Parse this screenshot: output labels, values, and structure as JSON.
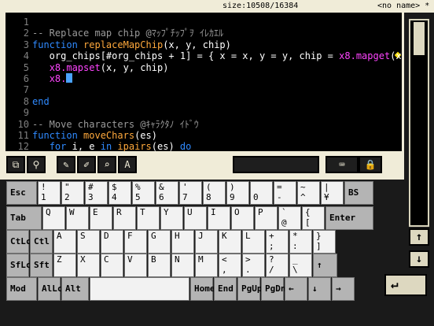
{
  "status": {
    "size": "size:10508/16384",
    "filename": "<no name> *"
  },
  "editor": {
    "lines": [
      {
        "n": "1",
        "segs": []
      },
      {
        "n": "2",
        "segs": [
          {
            "c": "cm",
            "t": "-- Replace map chip @ﾏｯﾌﾟﾁｯﾌﾟｦ ｲﾚｶｴﾙ"
          }
        ]
      },
      {
        "n": "3",
        "segs": [
          {
            "c": "kw",
            "t": "function "
          },
          {
            "c": "fn",
            "t": "replaceMapChip"
          },
          {
            "c": "tx",
            "t": "(x, y, chip)"
          }
        ]
      },
      {
        "n": "4",
        "segs": [
          {
            "c": "tx",
            "t": "   org_chips[#org_chips + 1] = { x = x, y = y, chip = "
          },
          {
            "c": "api",
            "t": "x8.mapget"
          },
          {
            "c": "tx",
            "t": "(x,"
          }
        ]
      },
      {
        "n": "5",
        "segs": [
          {
            "c": "tx",
            "t": "   "
          },
          {
            "c": "api",
            "t": "x8.mapset"
          },
          {
            "c": "tx",
            "t": "(x, y, chip)"
          }
        ]
      },
      {
        "n": "6",
        "segs": [
          {
            "c": "tx",
            "t": "   "
          },
          {
            "c": "api",
            "t": "x8."
          }
        ],
        "cursor": true
      },
      {
        "n": "7",
        "segs": []
      },
      {
        "n": "8",
        "segs": [
          {
            "c": "kw",
            "t": "end"
          }
        ]
      },
      {
        "n": "9",
        "segs": []
      },
      {
        "n": "10",
        "segs": [
          {
            "c": "cm",
            "t": "-- Move characters @ｷｬﾗｸﾀﾉ ｲﾄﾞｳ"
          }
        ]
      },
      {
        "n": "11",
        "segs": [
          {
            "c": "kw",
            "t": "function "
          },
          {
            "c": "fn",
            "t": "moveChars"
          },
          {
            "c": "tx",
            "t": "(es)"
          }
        ]
      },
      {
        "n": "12",
        "segs": [
          {
            "c": "tx",
            "t": "   "
          },
          {
            "c": "kw",
            "t": "for "
          },
          {
            "c": "tx",
            "t": "i, e "
          },
          {
            "c": "kw",
            "t": "in "
          },
          {
            "c": "fn",
            "t": "ipairs"
          },
          {
            "c": "tx",
            "t": "(es) "
          },
          {
            "c": "kw",
            "t": "do"
          }
        ]
      }
    ]
  },
  "toolbar": {
    "buttons": [
      {
        "name": "copy-button",
        "icon": "copy-icon",
        "label": "⧉"
      },
      {
        "name": "paste-button",
        "icon": "clipboard-icon",
        "label": "⚲"
      },
      {
        "name": "erase-button",
        "icon": "eraser-icon",
        "label": "✎"
      },
      {
        "name": "pen-button",
        "icon": "pen-icon",
        "label": "✐"
      },
      {
        "name": "search-button",
        "icon": "search-icon",
        "label": "⌕"
      },
      {
        "name": "font-button",
        "icon": "font-icon",
        "label": "A"
      },
      {
        "name": "blank-button",
        "icon": "blank-icon",
        "label": ""
      },
      {
        "name": "keyboard-button",
        "icon": "keyboard-icon",
        "label": "⌨"
      },
      {
        "name": "lock-button",
        "icon": "lock-icon",
        "label": "🔒"
      }
    ]
  },
  "keyboard": {
    "rows": [
      [
        {
          "k": "Esc",
          "s": "c",
          "dark": true
        },
        {
          "k": "!",
          "b": "1"
        },
        {
          "k": "\"",
          "b": "2"
        },
        {
          "k": "#",
          "b": "3"
        },
        {
          "k": "$",
          "b": "4"
        },
        {
          "k": "%",
          "b": "5"
        },
        {
          "k": "&",
          "b": "6"
        },
        {
          "k": "'",
          "b": "7"
        },
        {
          "k": "(",
          "b": "8"
        },
        {
          "k": ")",
          "b": "9"
        },
        {
          "k": "",
          "b": "0"
        },
        {
          "k": "=",
          "b": "-"
        },
        {
          "k": "~",
          "b": "^"
        },
        {
          "k": "|",
          "b": "¥"
        },
        {
          "k": "BS",
          "s": "c",
          "dark": true
        }
      ],
      [
        {
          "k": "Tab",
          "s": "c",
          "dark": true
        },
        {
          "k": "Q"
        },
        {
          "k": "W"
        },
        {
          "k": "E"
        },
        {
          "k": "R"
        },
        {
          "k": "T"
        },
        {
          "k": "Y"
        },
        {
          "k": "U"
        },
        {
          "k": "I"
        },
        {
          "k": "O"
        },
        {
          "k": "P"
        },
        {
          "k": "`",
          "b": "@"
        },
        {
          "k": "{",
          "b": "["
        },
        {
          "k": "Enter",
          "s": "c",
          "dark": true
        }
      ],
      [
        {
          "k": "CtLc",
          "s": "c",
          "dark": true
        },
        {
          "k": "Ctl",
          "s": "c",
          "dark": true
        },
        {
          "k": "A"
        },
        {
          "k": "S"
        },
        {
          "k": "D"
        },
        {
          "k": "F"
        },
        {
          "k": "G"
        },
        {
          "k": "H"
        },
        {
          "k": "J"
        },
        {
          "k": "K"
        },
        {
          "k": "L"
        },
        {
          "k": "+",
          "b": ";"
        },
        {
          "k": "*",
          "b": ":"
        },
        {
          "k": "}",
          "b": "]"
        }
      ],
      [
        {
          "k": "SfLc",
          "s": "c",
          "dark": true
        },
        {
          "k": "Sft",
          "s": "c",
          "dark": true
        },
        {
          "k": "Z"
        },
        {
          "k": "X"
        },
        {
          "k": "C"
        },
        {
          "k": "V"
        },
        {
          "k": "B"
        },
        {
          "k": "N"
        },
        {
          "k": "M"
        },
        {
          "k": "<",
          "b": ","
        },
        {
          "k": ">",
          "b": "."
        },
        {
          "k": "?",
          "b": "/"
        },
        {
          "k": "_",
          "b": "\\"
        },
        {
          "k": "↑",
          "s": "c",
          "dark": true
        }
      ],
      [
        {
          "k": "Mod",
          "s": "c",
          "dark": true
        },
        {
          "k": "AlLc",
          "s": "c",
          "dark": true
        },
        {
          "k": "Alt",
          "s": "c",
          "dark": true
        },
        {
          "k": "",
          "s": "c"
        },
        {
          "k": "Home",
          "s": "c",
          "dark": true
        },
        {
          "k": "End",
          "s": "c",
          "dark": true
        },
        {
          "k": "PgUp",
          "s": "c",
          "dark": true
        },
        {
          "k": "PgDn",
          "s": "c",
          "dark": true
        },
        {
          "k": "←",
          "s": "c",
          "dark": true
        },
        {
          "k": "↓",
          "s": "c",
          "dark": true
        },
        {
          "k": "→",
          "s": "c",
          "dark": true
        }
      ]
    ]
  },
  "side": {
    "up": "↑",
    "down": "↓",
    "return": "↵"
  }
}
